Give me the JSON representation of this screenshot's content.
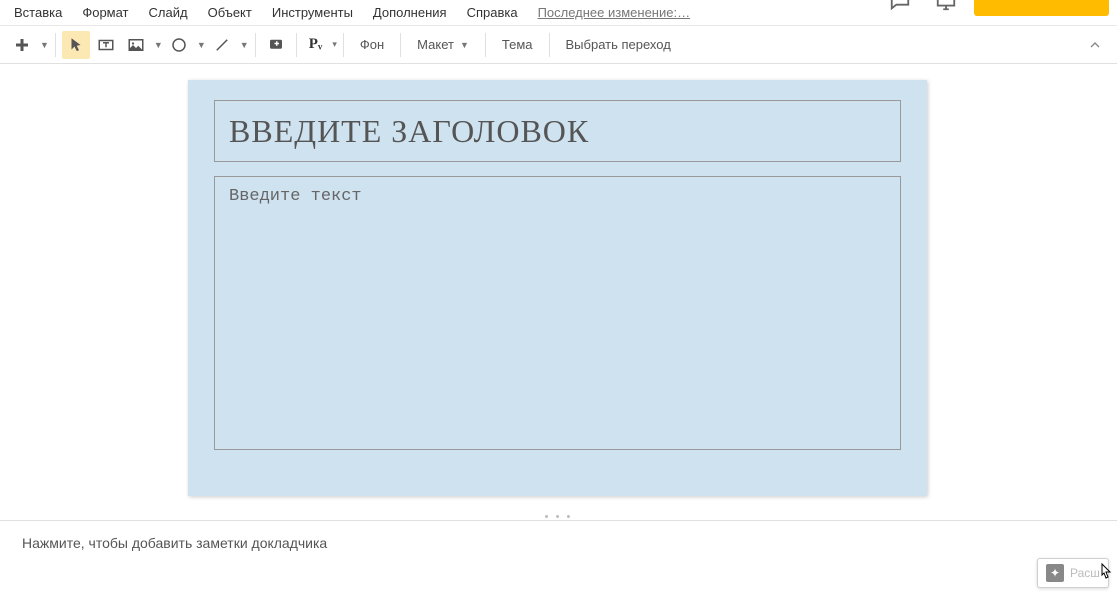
{
  "menu": {
    "items": [
      "Вставка",
      "Формат",
      "Слайд",
      "Объект",
      "Инструменты",
      "Дополнения",
      "Справка"
    ],
    "last_edit": "Последнее изменение:…"
  },
  "toolbar": {
    "pv_label": "Pᵥ",
    "background": "Фон",
    "layout": "Макет",
    "theme": "Тема",
    "transition": "Выбрать переход"
  },
  "slide": {
    "title_placeholder": "Введите заголовок",
    "body_placeholder": "Введите текст"
  },
  "notes": {
    "placeholder": "Нажмите, чтобы добавить заметки докладчика"
  },
  "explore": {
    "label": "Расш"
  }
}
